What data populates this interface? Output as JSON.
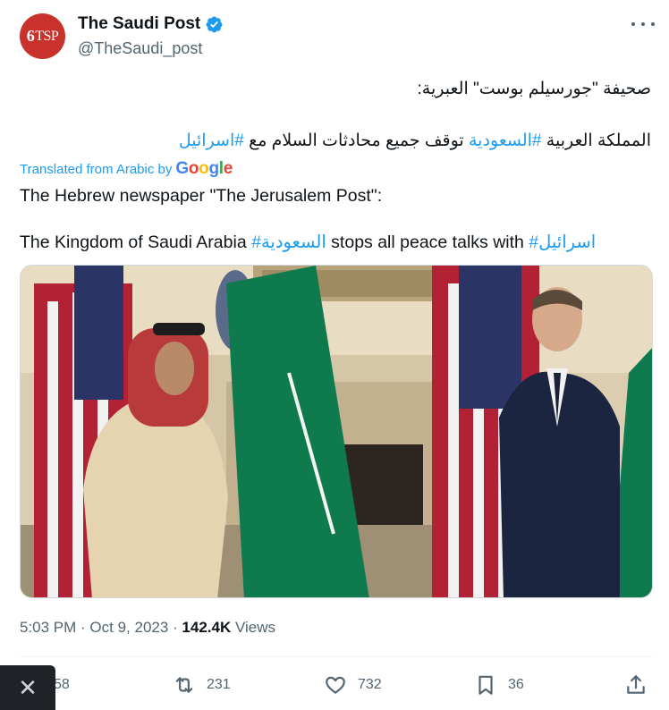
{
  "author": {
    "name": "The Saudi Post",
    "handle": "@TheSaudi_post",
    "avatar_text": "TSP",
    "avatar_color": "#c8312c",
    "verified_color": "#1d9bf0"
  },
  "original": {
    "line1": "صحيفة \"جورسيلم بوست\" العبرية:",
    "line2_before": "المملكة العربية ",
    "line2_hash1": "#السعودية",
    "line2_middle": " توقف جميع محادثات السلام مع ",
    "line2_hash2": "#اسرائيل"
  },
  "translation": {
    "label": "Translated from Arabic by",
    "provider": "Google",
    "line1": "The Hebrew newspaper \"The Jerusalem Post\":",
    "line2_before": "The Kingdom of Saudi Arabia ",
    "line2_hash1": "#السعودية",
    "line2_middle": " stops all peace talks with ",
    "line2_hash2": "#اسرائيل"
  },
  "meta": {
    "time": "5:03 PM",
    "sep1": " · ",
    "date": "Oct 9, 2023",
    "sep2": " · ",
    "views_count": "142.4K",
    "views_label": " Views"
  },
  "actions": {
    "replies": "58",
    "retweets": "231",
    "likes": "732",
    "bookmarks": "36"
  },
  "icons": [
    "verified-badge-icon",
    "more-icon",
    "reply-icon",
    "retweet-icon",
    "heart-icon",
    "bookmark-icon",
    "share-icon",
    "close-icon"
  ],
  "colors": {
    "accent": "#1d9bf0",
    "secondary_text": "#536471",
    "text": "#0f1419"
  }
}
